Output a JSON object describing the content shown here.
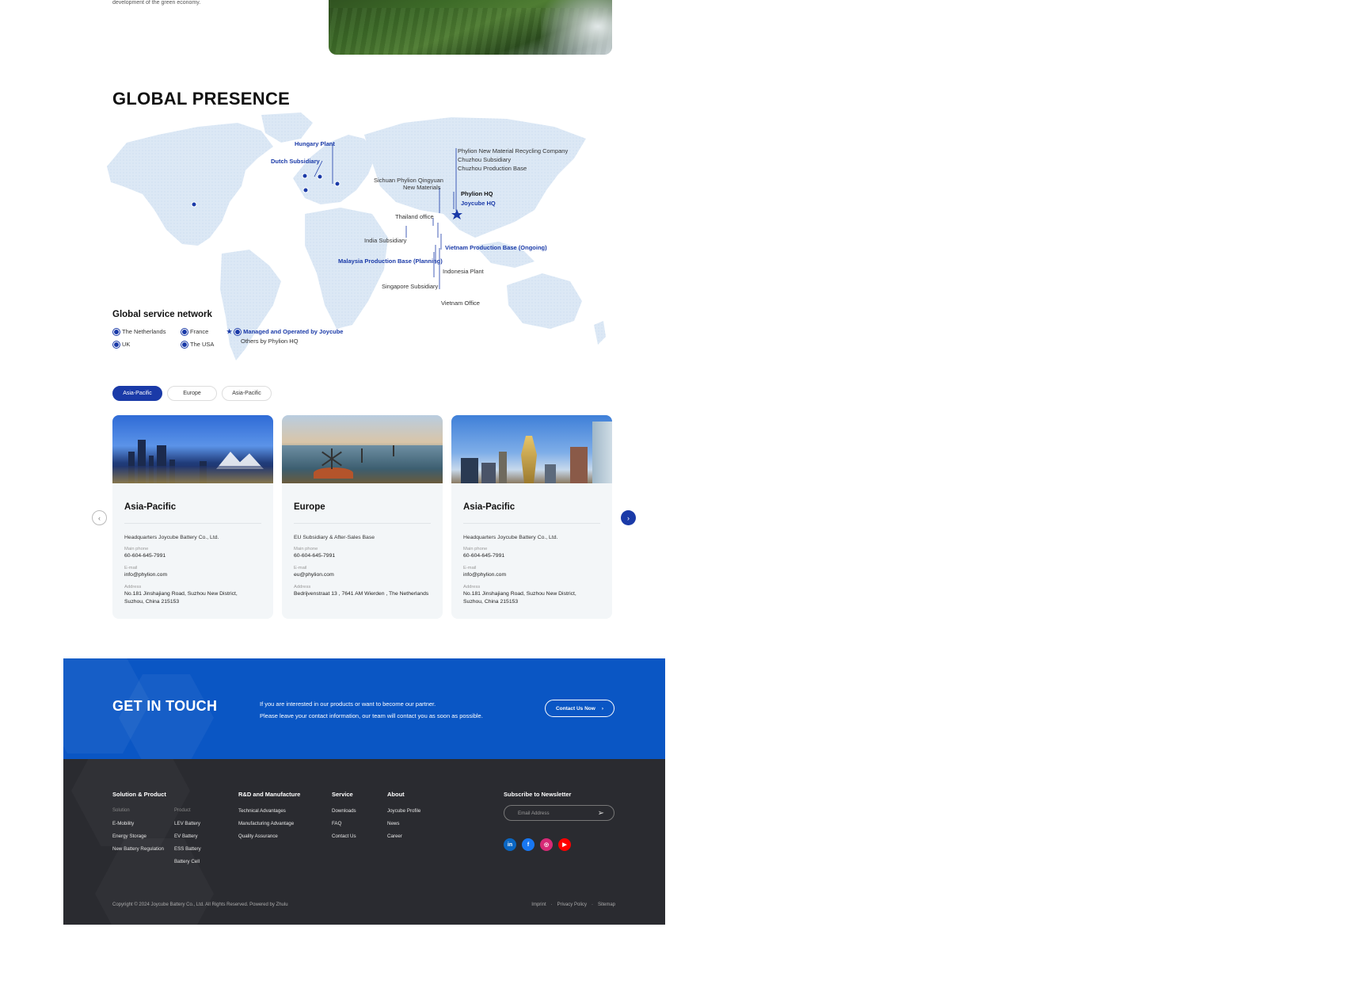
{
  "intro": {
    "text": "development of the green economy."
  },
  "section_title": "GLOBAL PRESENCE",
  "map": {
    "labels": {
      "hungary_plant": "Hungary Plant",
      "dutch_subsidiary": "Dutch Subsidiary",
      "phylion_recycling": "Phylion New Material Recycling Company",
      "chuzhou_subsidiary": "Chuzhou Subsidiary",
      "chuzhou_production": "Chuzhou Production Base",
      "sichuan_1": "Sichuan Phylion Qingyuan",
      "sichuan_2": "New Materials",
      "phylion_hq": "Phylion HQ",
      "joycube_hq": "Joycube HQ",
      "thailand_office": "Thailand office",
      "india_subsidiary": "India Subsidiary",
      "vietnam_production": "Vietnam Production Base (Ongoing)",
      "malaysia_production": "Malaysia Production Base (Planning)",
      "indonesia_plant": "Indonesia Plant",
      "singapore_subsidiary": "Singapore Subsidiary",
      "vietnam_office": "Vietnam Office"
    }
  },
  "service_network": {
    "title": "Global service network",
    "items": [
      "The Netherlands",
      "France",
      "UK",
      "The USA"
    ],
    "managed": "Managed and Operated by Joycube",
    "others": "Others by Phylion HQ"
  },
  "tabs": [
    {
      "label": "Asia-Pacific",
      "active": true
    },
    {
      "label": "Europe",
      "active": false
    },
    {
      "label": "Asia-Pacific",
      "active": false
    }
  ],
  "cards": [
    {
      "title": "Asia-Pacific",
      "hq": "Headquarters Joycube Battery Co., Ltd.",
      "phone_label": "Main phone",
      "phone": "60-604-645-7991",
      "email_label": "E-mail",
      "email": "info@phylion.com",
      "address_label": "Address",
      "address_1": "No.181 Jinshajiang Road, Suzhou New District,",
      "address_2": "Suzhou, China 215153"
    },
    {
      "title": "Europe",
      "hq": "EU Subsidiary & After-Sales Base",
      "phone_label": "Main phone",
      "phone": "60-604-645-7991",
      "email_label": "E-mail",
      "email": "eu@phylion.com",
      "address_label": "Address",
      "address_1": "Bedrijvenstraat 13 , 7641 AM Wierden , The Netherlands",
      "address_2": ""
    },
    {
      "title": "Asia-Pacific",
      "hq": "Headquarters Joycube Battery Co., Ltd.",
      "phone_label": "Main phone",
      "phone": "60-604-645-7991",
      "email_label": "E-mail",
      "email": "info@phylion.com",
      "address_label": "Address",
      "address_1": "No.181 Jinshajiang Road, Suzhou New District,",
      "address_2": "Suzhou, China 215153"
    }
  ],
  "get_in_touch": {
    "title": "GET IN TOUCH",
    "line1": "If you are interested in our products or want to become our partner.",
    "line2": "Please leave your contact information, our team will contact you as soon as possible.",
    "button": "Contact Us Now"
  },
  "footer": {
    "solution_title": "Solution & Product",
    "solution_sub": "Solution",
    "solution_items": [
      "E-Mobility",
      "Energy Storage",
      "New Battery Regulation"
    ],
    "product_sub": "Product",
    "product_items": [
      "LEV Battery",
      "EV Battery",
      "ESS Battery",
      "Battery Cell"
    ],
    "rd_title": "R&D and Manufacture",
    "rd_items": [
      "Technical Advantages",
      "Manufacturing Advantage",
      "Quality Assurance"
    ],
    "service_title": "Service",
    "service_items": [
      "Downloads",
      "FAQ",
      "Contact Us"
    ],
    "about_title": "About",
    "about_items": [
      "Joycube Profile",
      "News",
      "Career"
    ],
    "newsletter_title": "Subscribe to Newsletter",
    "email_placeholder": "Email Address",
    "social": [
      "linkedin-icon",
      "facebook-icon",
      "instagram-icon",
      "youtube-icon"
    ],
    "social_colors": [
      "#0a66c2",
      "#1877f2",
      "#d62976",
      "#ff0000"
    ],
    "copyright": "Copyright © 2024 Joycube Battery Co., Ltd. All Rights Reserved. Powered by Zhulu",
    "legal": [
      "Imprint",
      "Privacy Policy",
      "Sitemap"
    ]
  }
}
